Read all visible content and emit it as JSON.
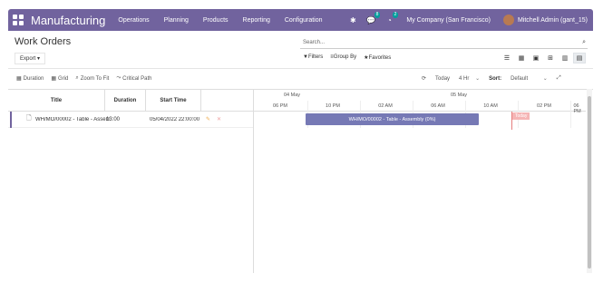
{
  "navbar": {
    "brand": "Manufacturing",
    "menu": [
      "Operations",
      "Planning",
      "Products",
      "Reporting",
      "Configuration"
    ],
    "chat_badge": "8",
    "activity_badge": "2",
    "company": "My Company (San Francisco)",
    "user": "Mitchell Admin (gant_15)"
  },
  "control_panel": {
    "title": "Work Orders",
    "export_label": "Export",
    "search_placeholder": "Search...",
    "filters_label": "Filters",
    "groupby_label": "Group By",
    "favorites_label": "Favorites"
  },
  "gantt_toolbar": {
    "duration_label": "Duration",
    "grid_label": "Grid",
    "zoom_label": "Zoom To Fit",
    "critical_label": "Critical Path",
    "today_label": "Today",
    "scale_label": "4 Hr",
    "sort_label": "Sort:",
    "sort_value": "Default"
  },
  "gantt": {
    "columns": [
      "Title",
      "Duration",
      "Start Time"
    ],
    "dates": [
      "04 May",
      "05 May"
    ],
    "hours": [
      "06 PM",
      "10 PM",
      "02 AM",
      "06 AM",
      "10 AM",
      "02 PM",
      "06 PM"
    ],
    "rows": [
      {
        "title": "WH/MO/00002 - Table - Assembly",
        "duration": "13:00",
        "start": "05/04/2022 22:00:00"
      }
    ],
    "task_label": "WH/MO/00002 - Table - Assembly (0%)",
    "today_text": "Today"
  },
  "colors": {
    "navbar": "#71639e",
    "task_bar": "#7679b5",
    "today": "#e67e7e"
  }
}
